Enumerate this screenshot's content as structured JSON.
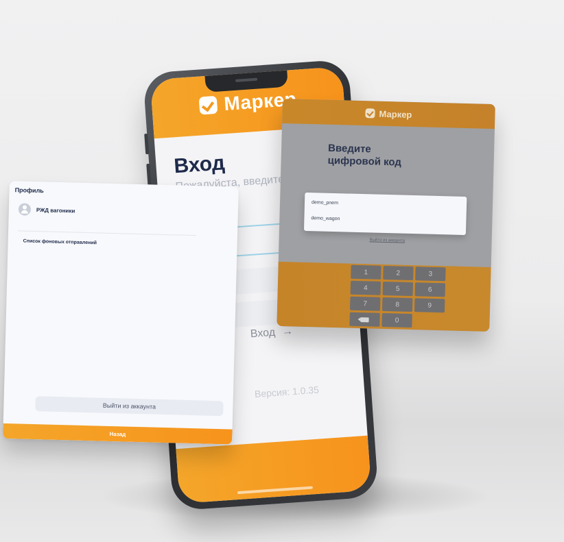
{
  "phone": {
    "brand": "Маркер",
    "title": "Вход",
    "subtitle": "Пожалуйста, введите сво",
    "login_button": "Вход",
    "login_arrow": "→",
    "version": "Версия: 1.0.35"
  },
  "profile": {
    "header": "Профиль",
    "user_name": "РЖД вагоники",
    "section_title": "Список фоновых отправлений",
    "logout_button": "Выйти из аккаунта",
    "back_button": "Назад"
  },
  "pin": {
    "brand": "Маркер",
    "title_line1": "Введите",
    "title_line2": "цифровой код",
    "options": [
      "demo_pnem",
      "demo_wagon"
    ],
    "logout_link": "Выйти из аккаунта",
    "keys": [
      "1",
      "2",
      "3",
      "4",
      "5",
      "6",
      "7",
      "8",
      "9",
      "",
      "0"
    ],
    "backspace_icon": "backspace-icon"
  },
  "colors": {
    "brand_orange": "#f7931c",
    "dark_text": "#1e2a4a",
    "pin_overlay": "#9fa0a3",
    "pin_orange_dim": "#c6822a"
  }
}
